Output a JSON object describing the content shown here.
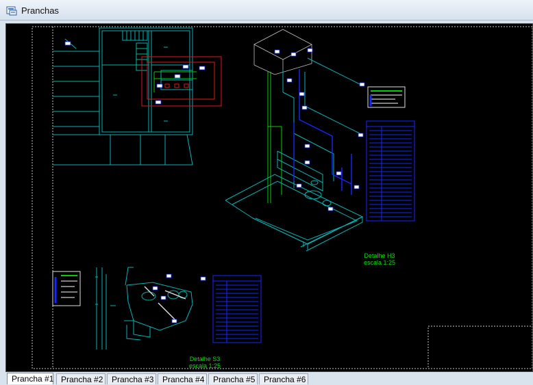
{
  "window": {
    "title": "Pranchas"
  },
  "drawing": {
    "detail_h3_title": "Detalhe H3",
    "detail_h3_scale": "escala 1:25",
    "detail_s3_title": "Detalhe S3",
    "detail_s3_scale": "escala 1:25"
  },
  "tabs": [
    {
      "label": "Prancha #1",
      "active": true
    },
    {
      "label": "Prancha #2",
      "active": false
    },
    {
      "label": "Prancha #3",
      "active": false
    },
    {
      "label": "Prancha #4",
      "active": false
    },
    {
      "label": "Prancha #5",
      "active": false
    },
    {
      "label": "Prancha #6",
      "active": false
    }
  ],
  "colors": {
    "background": "#000000",
    "cyan_lines": "#00b4b4",
    "green_lines": "#00d000",
    "blue_lines": "#1428ff",
    "red_lines": "#e01818",
    "label_green": "#00e000"
  }
}
